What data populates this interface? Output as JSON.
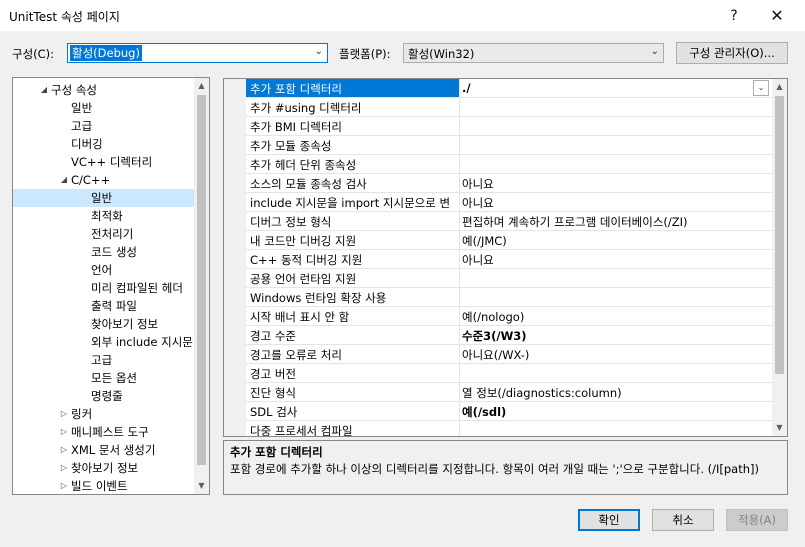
{
  "window": {
    "title": "UnitTest 속성 페이지",
    "help": "?",
    "close": "✕"
  },
  "config": {
    "config_label": "구성(C):",
    "config_value": "활성(Debug)",
    "platform_label": "플랫폼(P):",
    "platform_value": "활성(Win32)",
    "manager_button": "구성 관리자(O)..."
  },
  "tree": [
    {
      "label": "구성 속성",
      "level": 0,
      "expander": "◢",
      "selected": false
    },
    {
      "label": "일반",
      "level": 1,
      "expander": "",
      "selected": false
    },
    {
      "label": "고급",
      "level": 1,
      "expander": "",
      "selected": false
    },
    {
      "label": "디버깅",
      "level": 1,
      "expander": "",
      "selected": false
    },
    {
      "label": "VC++ 디렉터리",
      "level": 1,
      "expander": "",
      "selected": false
    },
    {
      "label": "C/C++",
      "level": 1,
      "expander": "◢",
      "selected": false
    },
    {
      "label": "일반",
      "level": 2,
      "expander": "",
      "selected": true
    },
    {
      "label": "최적화",
      "level": 2,
      "expander": "",
      "selected": false
    },
    {
      "label": "전처리기",
      "level": 2,
      "expander": "",
      "selected": false
    },
    {
      "label": "코드 생성",
      "level": 2,
      "expander": "",
      "selected": false
    },
    {
      "label": "언어",
      "level": 2,
      "expander": "",
      "selected": false
    },
    {
      "label": "미리 컴파일된 헤더",
      "level": 2,
      "expander": "",
      "selected": false
    },
    {
      "label": "출력 파일",
      "level": 2,
      "expander": "",
      "selected": false
    },
    {
      "label": "찾아보기 정보",
      "level": 2,
      "expander": "",
      "selected": false
    },
    {
      "label": "외부 include 지시문",
      "level": 2,
      "expander": "",
      "selected": false
    },
    {
      "label": "고급",
      "level": 2,
      "expander": "",
      "selected": false
    },
    {
      "label": "모든 옵션",
      "level": 2,
      "expander": "",
      "selected": false
    },
    {
      "label": "명령줄",
      "level": 2,
      "expander": "",
      "selected": false
    },
    {
      "label": "링커",
      "level": 1,
      "expander": "▷",
      "selected": false
    },
    {
      "label": "매니페스트 도구",
      "level": 1,
      "expander": "▷",
      "selected": false
    },
    {
      "label": "XML 문서 생성기",
      "level": 1,
      "expander": "▷",
      "selected": false
    },
    {
      "label": "찾아보기 정보",
      "level": 1,
      "expander": "▷",
      "selected": false
    },
    {
      "label": "빌드 이벤트",
      "level": 1,
      "expander": "▷",
      "selected": false
    }
  ],
  "grid": [
    {
      "name": "추가 포함 디렉터리",
      "value": "./",
      "bold": true,
      "selected": true
    },
    {
      "name": "추가 #using 디렉터리",
      "value": "",
      "bold": false,
      "selected": false
    },
    {
      "name": "추가 BMI 디렉터리",
      "value": "",
      "bold": false,
      "selected": false
    },
    {
      "name": "추가 모듈 종속성",
      "value": "",
      "bold": false,
      "selected": false
    },
    {
      "name": "추가 헤더 단위 종속성",
      "value": "",
      "bold": false,
      "selected": false
    },
    {
      "name": "소스의 모듈 종속성 검사",
      "value": "아니요",
      "bold": false,
      "selected": false
    },
    {
      "name": "include 지시문을 import 지시문으로 변",
      "value": "아니요",
      "bold": false,
      "selected": false
    },
    {
      "name": "디버그 정보 형식",
      "value": "편집하며 계속하기 프로그램 데이터베이스(/ZI)",
      "bold": false,
      "selected": false
    },
    {
      "name": "내 코드만 디버깅 지원",
      "value": "예(/JMC)",
      "bold": false,
      "selected": false
    },
    {
      "name": "C++ 동적 디버깅 지원",
      "value": "아니요",
      "bold": false,
      "selected": false
    },
    {
      "name": "공용 언어 런타임 지원",
      "value": "",
      "bold": false,
      "selected": false
    },
    {
      "name": "Windows 런타임 확장 사용",
      "value": "",
      "bold": false,
      "selected": false
    },
    {
      "name": "시작 배너 표시 안 함",
      "value": "예(/nologo)",
      "bold": false,
      "selected": false
    },
    {
      "name": "경고 수준",
      "value": "수준3(/W3)",
      "bold": true,
      "selected": false
    },
    {
      "name": "경고를 오류로 처리",
      "value": "아니요(/WX-)",
      "bold": false,
      "selected": false
    },
    {
      "name": "경고 버전",
      "value": "",
      "bold": false,
      "selected": false
    },
    {
      "name": "진단 형식",
      "value": "열 정보(/diagnostics:column)",
      "bold": false,
      "selected": false
    },
    {
      "name": "SDL 검사",
      "value": "예(/sdl)",
      "bold": true,
      "selected": false
    },
    {
      "name": "다중 프로세서 컴파일",
      "value": "",
      "bold": false,
      "selected": false
    }
  ],
  "description": {
    "title": "추가 포함 디렉터리",
    "text": "포함 경로에 추가할 하나 이상의 디렉터리를 지정합니다. 항목이 여러 개일 때는 ';'으로 구분합니다. (/I[path])"
  },
  "buttons": {
    "ok": "확인",
    "cancel": "취소",
    "apply": "적용(A)"
  }
}
